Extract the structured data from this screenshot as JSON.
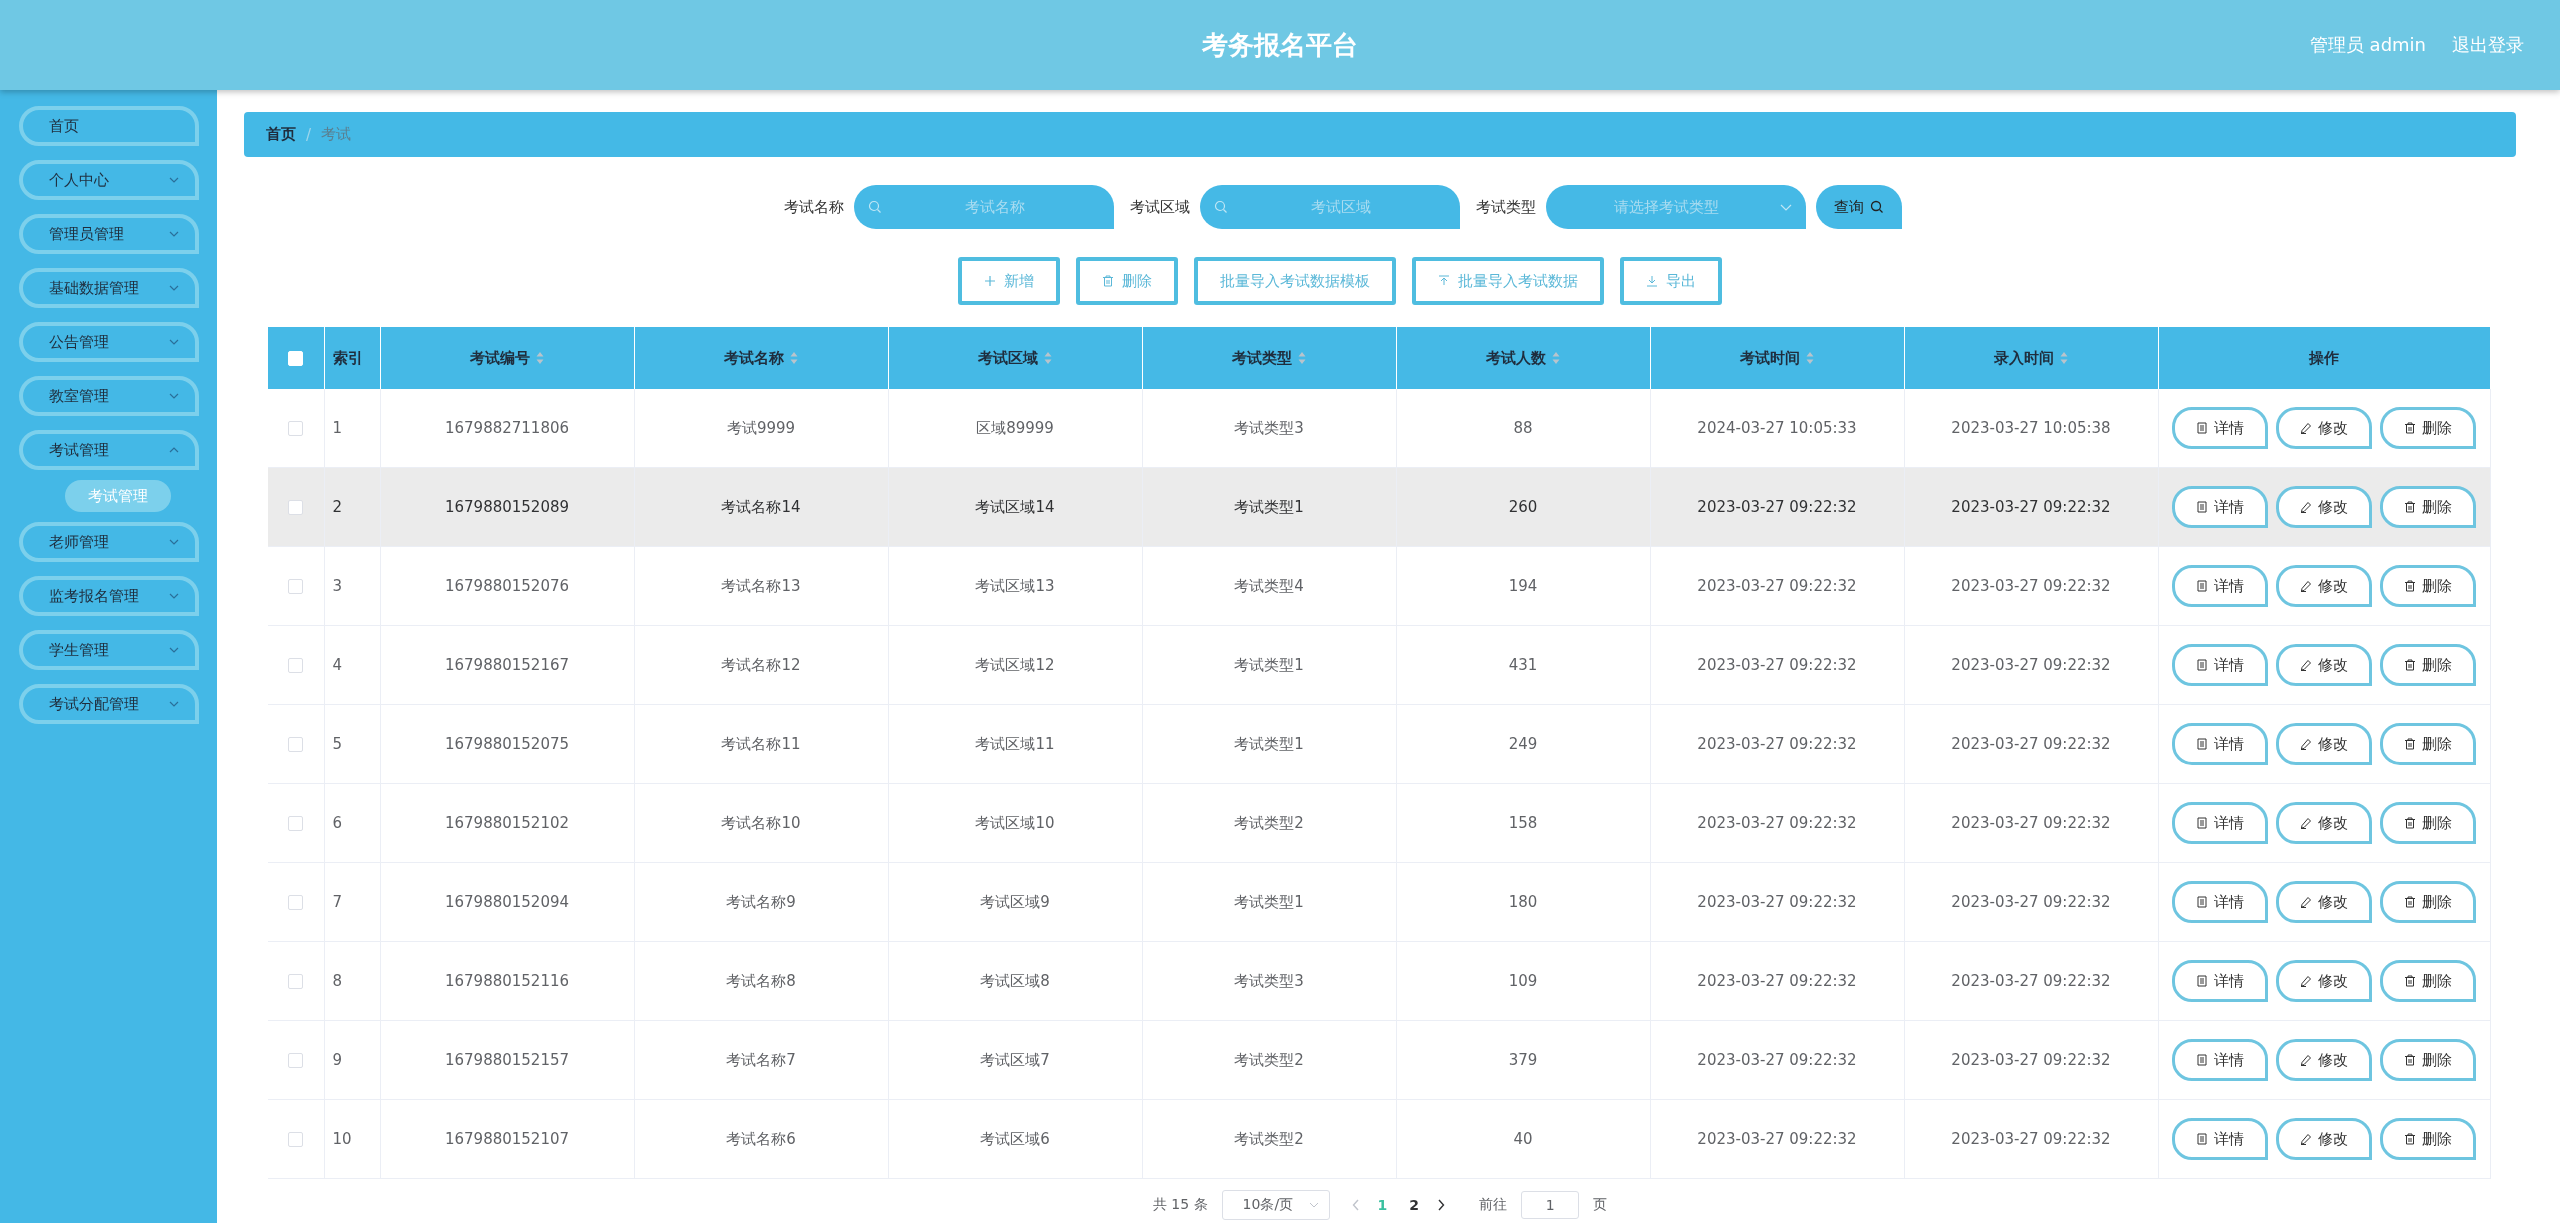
{
  "header": {
    "title": "考务报名平台",
    "user": "管理员 admin",
    "logout": "退出登录"
  },
  "sidebar": {
    "items": [
      {
        "label": "首页",
        "expandable": false
      },
      {
        "label": "个人中心",
        "expandable": true,
        "expanded": false
      },
      {
        "label": "管理员管理",
        "expandable": true,
        "expanded": false
      },
      {
        "label": "基础数据管理",
        "expandable": true,
        "expanded": false
      },
      {
        "label": "公告管理",
        "expandable": true,
        "expanded": false
      },
      {
        "label": "教室管理",
        "expandable": true,
        "expanded": false
      },
      {
        "label": "考试管理",
        "expandable": true,
        "expanded": true,
        "children": [
          {
            "label": "考试管理",
            "selected": true
          }
        ]
      },
      {
        "label": "老师管理",
        "expandable": true,
        "expanded": false
      },
      {
        "label": "监考报名管理",
        "expandable": true,
        "expanded": false
      },
      {
        "label": "学生管理",
        "expandable": true,
        "expanded": false
      },
      {
        "label": "考试分配管理",
        "expandable": true,
        "expanded": false
      }
    ]
  },
  "breadcrumb": [
    {
      "label": "首页",
      "selected": false
    },
    {
      "separator": "/",
      "label": "考试",
      "selected": true
    }
  ],
  "search": {
    "fields": [
      {
        "kind": "input",
        "label": "考试名称",
        "placeholder": "考试名称"
      },
      {
        "kind": "input",
        "label": "考试区域",
        "placeholder": "考试区域"
      },
      {
        "kind": "select",
        "label": "考试类型",
        "placeholder": "请选择考试类型"
      }
    ],
    "button": "查询"
  },
  "toolbar": [
    {
      "kind": "add",
      "label": "新增"
    },
    {
      "kind": "delete",
      "label": "删除"
    },
    {
      "kind": "template",
      "label": "批量导入考试数据模板"
    },
    {
      "kind": "import",
      "label": "批量导入考试数据"
    },
    {
      "kind": "export",
      "label": "导出"
    }
  ],
  "table": {
    "columns": [
      {
        "label": "索引",
        "sortable": false
      },
      {
        "label": "考试编号",
        "sortable": true
      },
      {
        "label": "考试名称",
        "sortable": true
      },
      {
        "label": "考试区域",
        "sortable": true
      },
      {
        "label": "考试类型",
        "sortable": true
      },
      {
        "label": "考试人数",
        "sortable": true
      },
      {
        "label": "考试时间",
        "sortable": true
      },
      {
        "label": "录入时间",
        "sortable": true
      },
      {
        "label": "操作",
        "sortable": false
      }
    ],
    "select_all_checked": false,
    "rows": [
      {
        "checked": false,
        "hovered": false,
        "cells": [
          "1",
          "1679882711806",
          "考试9999",
          "区域89999",
          "考试类型3",
          "88",
          "2024-03-27 10:05:33",
          "2023-03-27 10:05:38"
        ],
        "actions": [
          {
            "kind": "detail",
            "label": "详情"
          },
          {
            "kind": "edit",
            "label": "修改"
          },
          {
            "kind": "delete",
            "label": "删除"
          }
        ]
      },
      {
        "checked": false,
        "hovered": true,
        "cells": [
          "2",
          "1679880152089",
          "考试名称14",
          "考试区域14",
          "考试类型1",
          "260",
          "2023-03-27 09:22:32",
          "2023-03-27 09:22:32"
        ],
        "actions": [
          {
            "kind": "detail",
            "label": "详情"
          },
          {
            "kind": "edit",
            "label": "修改"
          },
          {
            "kind": "delete",
            "label": "删除"
          }
        ]
      },
      {
        "checked": false,
        "hovered": false,
        "cells": [
          "3",
          "1679880152076",
          "考试名称13",
          "考试区域13",
          "考试类型4",
          "194",
          "2023-03-27 09:22:32",
          "2023-03-27 09:22:32"
        ],
        "actions": [
          {
            "kind": "detail",
            "label": "详情"
          },
          {
            "kind": "edit",
            "label": "修改"
          },
          {
            "kind": "delete",
            "label": "删除"
          }
        ]
      },
      {
        "checked": false,
        "hovered": false,
        "cells": [
          "4",
          "1679880152167",
          "考试名称12",
          "考试区域12",
          "考试类型1",
          "431",
          "2023-03-27 09:22:32",
          "2023-03-27 09:22:32"
        ],
        "actions": [
          {
            "kind": "detail",
            "label": "详情"
          },
          {
            "kind": "edit",
            "label": "修改"
          },
          {
            "kind": "delete",
            "label": "删除"
          }
        ]
      },
      {
        "checked": false,
        "hovered": false,
        "cells": [
          "5",
          "1679880152075",
          "考试名称11",
          "考试区域11",
          "考试类型1",
          "249",
          "2023-03-27 09:22:32",
          "2023-03-27 09:22:32"
        ],
        "actions": [
          {
            "kind": "detail",
            "label": "详情"
          },
          {
            "kind": "edit",
            "label": "修改"
          },
          {
            "kind": "delete",
            "label": "删除"
          }
        ]
      },
      {
        "checked": false,
        "hovered": false,
        "cells": [
          "6",
          "1679880152102",
          "考试名称10",
          "考试区域10",
          "考试类型2",
          "158",
          "2023-03-27 09:22:32",
          "2023-03-27 09:22:32"
        ],
        "actions": [
          {
            "kind": "detail",
            "label": "详情"
          },
          {
            "kind": "edit",
            "label": "修改"
          },
          {
            "kind": "delete",
            "label": "删除"
          }
        ]
      },
      {
        "checked": false,
        "hovered": false,
        "cells": [
          "7",
          "1679880152094",
          "考试名称9",
          "考试区域9",
          "考试类型1",
          "180",
          "2023-03-27 09:22:32",
          "2023-03-27 09:22:32"
        ],
        "actions": [
          {
            "kind": "detail",
            "label": "详情"
          },
          {
            "kind": "edit",
            "label": "修改"
          },
          {
            "kind": "delete",
            "label": "删除"
          }
        ]
      },
      {
        "checked": false,
        "hovered": false,
        "cells": [
          "8",
          "1679880152116",
          "考试名称8",
          "考试区域8",
          "考试类型3",
          "109",
          "2023-03-27 09:22:32",
          "2023-03-27 09:22:32"
        ],
        "actions": [
          {
            "kind": "detail",
            "label": "详情"
          },
          {
            "kind": "edit",
            "label": "修改"
          },
          {
            "kind": "delete",
            "label": "删除"
          }
        ]
      },
      {
        "checked": false,
        "hovered": false,
        "cells": [
          "9",
          "1679880152157",
          "考试名称7",
          "考试区域7",
          "考试类型2",
          "379",
          "2023-03-27 09:22:32",
          "2023-03-27 09:22:32"
        ],
        "actions": [
          {
            "kind": "detail",
            "label": "详情"
          },
          {
            "kind": "edit",
            "label": "修改"
          },
          {
            "kind": "delete",
            "label": "删除"
          }
        ]
      },
      {
        "checked": false,
        "hovered": false,
        "cells": [
          "10",
          "1679880152107",
          "考试名称6",
          "考试区域6",
          "考试类型2",
          "40",
          "2023-03-27 09:22:32",
          "2023-03-27 09:22:32"
        ],
        "actions": [
          {
            "kind": "detail",
            "label": "详情"
          },
          {
            "kind": "edit",
            "label": "修改"
          },
          {
            "kind": "delete",
            "label": "删除"
          }
        ]
      }
    ]
  },
  "pagination": {
    "total": "共 15 条",
    "page_size": "10条/页",
    "prev_disabled": true,
    "pages": [
      {
        "label": "1",
        "selected": true
      },
      {
        "label": "2",
        "selected": false
      }
    ],
    "goto_label": "前往",
    "goto_value": "1",
    "goto_suffix": "页"
  }
}
